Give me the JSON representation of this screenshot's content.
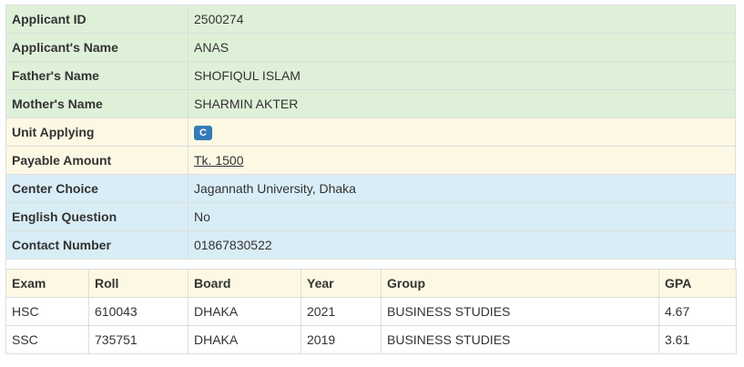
{
  "applicant": {
    "id": {
      "label": "Applicant ID",
      "value": "2500274"
    },
    "name": {
      "label": "Applicant's Name",
      "value": "ANAS"
    },
    "father": {
      "label": "Father's Name",
      "value": "SHOFIQUL ISLAM"
    },
    "mother": {
      "label": "Mother's Name",
      "value": "SHARMIN AKTER"
    },
    "unit": {
      "label": "Unit Applying",
      "value": "C"
    },
    "amount": {
      "label": "Payable Amount",
      "value": "Tk. 1500"
    },
    "center": {
      "label": "Center Choice",
      "value": "Jagannath University, Dhaka"
    },
    "english": {
      "label": "English Question",
      "value": "No"
    },
    "contact": {
      "label": "Contact Number",
      "value": "01867830522"
    }
  },
  "results": {
    "headers": [
      "Exam",
      "Roll",
      "Board",
      "Year",
      "Group",
      "GPA"
    ],
    "rows": [
      [
        "HSC",
        "610043",
        "DHAKA",
        "2021",
        "BUSINESS STUDIES",
        "4.67"
      ],
      [
        "SSC",
        "735751",
        "DHAKA",
        "2019",
        "BUSINESS STUDIES",
        "3.61"
      ]
    ]
  },
  "colors": {
    "green_row": "#dff0d8",
    "yellow_row": "#fcf8e3",
    "blue_row": "#d9edf7",
    "badge": "#337ab7",
    "border": "#dddddd"
  }
}
